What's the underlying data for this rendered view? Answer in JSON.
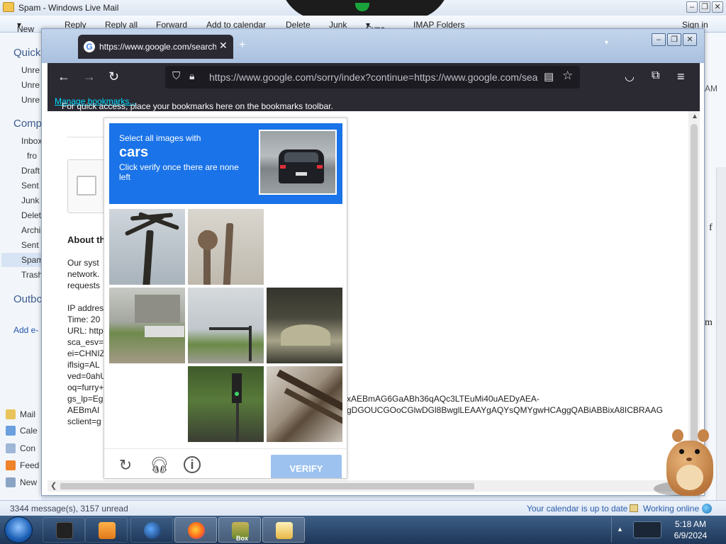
{
  "wlm": {
    "title": "Spam - Windows Live Mail",
    "toolbar": [
      "New",
      "Reply",
      "Reply all",
      "Forward",
      "Add to calendar",
      "Delete",
      "Junk",
      "Sync",
      "IMAP Folders"
    ],
    "sign_in": "Sign in",
    "left": {
      "quick": "Quick",
      "quick_items": [
        "Unre",
        "Unre",
        "Unre"
      ],
      "comp": "Comp",
      "comp_items": [
        "Inbox",
        "fro",
        "Draft",
        "Sent",
        "Junk",
        "Delet",
        "Archi",
        "Sent",
        "Spam",
        "Trash"
      ],
      "outbox": "Outbo",
      "add": "Add e-",
      "nav": [
        "Mail",
        "Cale",
        "Con",
        "Feed",
        "New"
      ]
    },
    "right": {
      "am": "AM",
      "f": "f",
      "m": "m"
    },
    "status": {
      "messages": "3344 message(s), 3157 unread",
      "calendar": "Your calendar is up to date",
      "online": "Working online"
    }
  },
  "firefox": {
    "tab_title": "https://www.google.com/search",
    "url": "https://www.google.com/sorry/index?continue=https://www.google.com/sea",
    "bookmarks_text": "For quick access, place your bookmarks here on the bookmarks toolbar.",
    "bookmarks_link": "Manage bookmarks...",
    "page": {
      "about": "About th",
      "lines1": [
        "Our syst",
        "network.",
        "requests"
      ],
      "lines2": [
        "IP addres",
        "Time: 20",
        "URL: http",
        "sca_esv=",
        "ei=CHNIZ",
        "iflsig=AL",
        "ved=0ahU",
        "oq=furry+",
        "gs_lp=Eg",
        "AEBmAI",
        "sclient=g"
      ],
      "tail1": "xAEBmAG6GaABh36qAQc3LTEuMi40uAEDyAEA-",
      "tail2": "gDGOUCGOoCGlwDGl8BwglLEAAYgAQYsQMYgwHCAggQABiABBixA8ICBRAAG"
    }
  },
  "recaptcha": {
    "line1": "Select all images with",
    "target": "cars",
    "line3": "Click verify once there are none left",
    "verify": "VERIFY"
  },
  "taskbar": {
    "time": "5:18 AM",
    "date": "6/9/2024",
    "box_label": "Box"
  }
}
